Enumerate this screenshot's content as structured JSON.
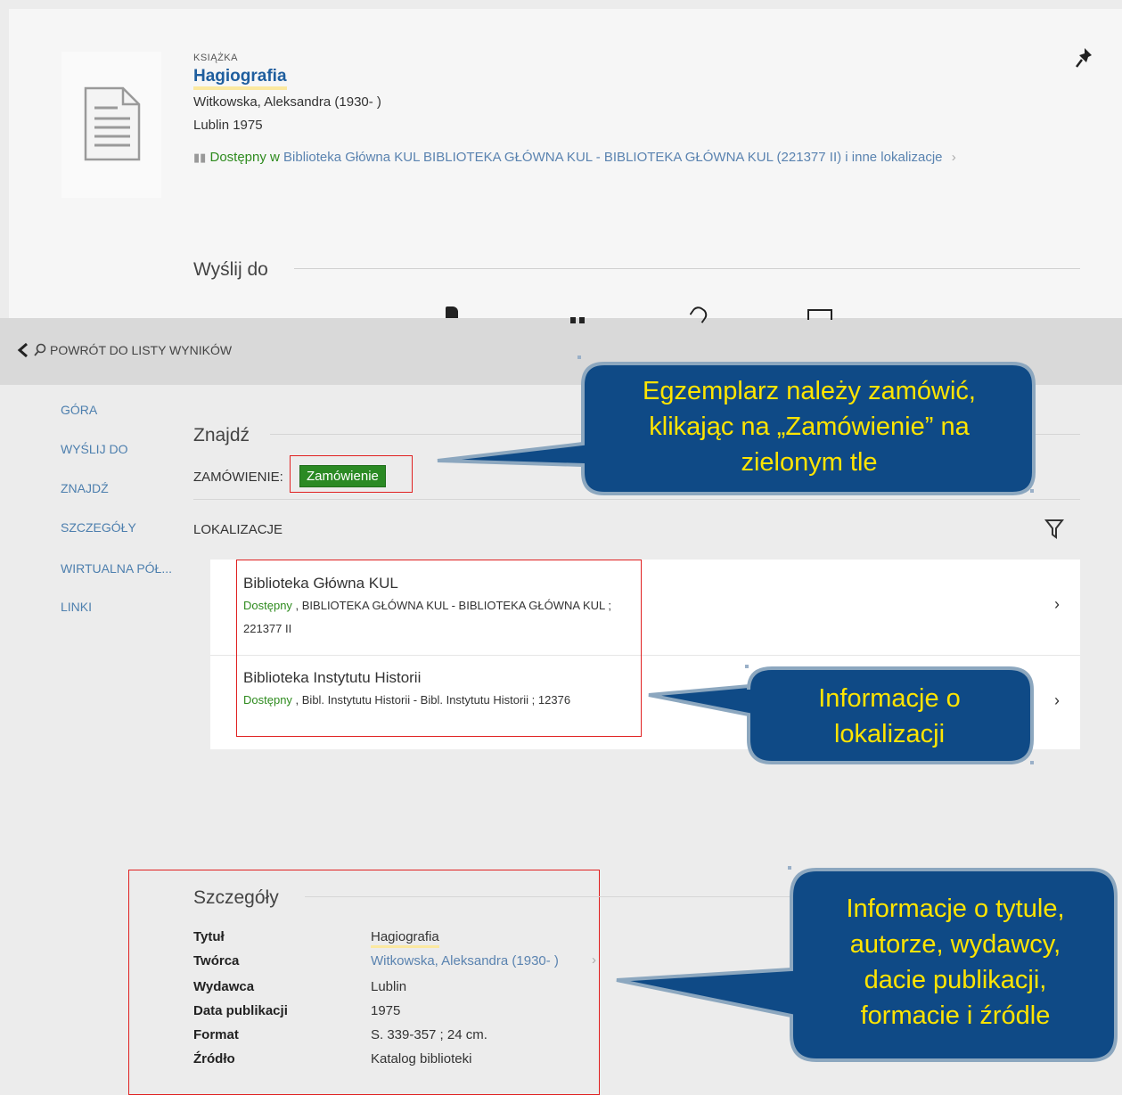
{
  "record": {
    "type": "KSIĄŻKA",
    "title": "Hagiografia",
    "author": "Witkowska, Aleksandra (1930- )",
    "place_year": "Lublin 1975",
    "availability_status": "Dostępny w",
    "availability_location": " Biblioteka Główna KUL  BIBLIOTEKA GŁÓWNA KUL - BIBLIOTEKA GŁÓWNA KUL (221377 II) i inne lokalizacje",
    "availability_chevron": "›"
  },
  "send_to": {
    "title": "Wyślij do"
  },
  "nav": {
    "back_label": "POWRÓT DO LISTY WYNIKÓW"
  },
  "sidebar": {
    "items": [
      {
        "label": "GÓRA"
      },
      {
        "label": "WYŚLIJ DO"
      },
      {
        "label": "ZNAJDŹ"
      },
      {
        "label": "SZCZEGÓŁY"
      },
      {
        "label": "WIRTUALNA PÓŁ..."
      },
      {
        "label": "LINKI"
      }
    ]
  },
  "find": {
    "title": "Znajdź",
    "order_label": "ZAMÓWIENIE:",
    "order_button": "Zamówienie",
    "locations_label": "LOKALIZACJE"
  },
  "locations": [
    {
      "name": "Biblioteka Główna KUL",
      "status": "Dostępny",
      "details": " , BIBLIOTEKA GŁÓWNA KUL - BIBLIOTEKA GŁÓWNA KUL ; 221377 II",
      "chevron": "›"
    },
    {
      "name": "Biblioteka Instytutu Historii",
      "status": "Dostępny",
      "details": " , Bibl. Instytutu Historii - Bibl. Instytutu Historii ; 12376",
      "chevron": "›"
    }
  ],
  "details": {
    "title": "Szczegóły",
    "rows": [
      {
        "key": "Tytuł",
        "value": "Hagiografia"
      },
      {
        "key": "Twórca",
        "value": "Witkowska, Aleksandra (1930- )"
      },
      {
        "key": "Wydawca",
        "value": "Lublin"
      },
      {
        "key": "Data publikacji",
        "value": "1975"
      },
      {
        "key": "Format",
        "value": "S. 339-357 ; 24 cm."
      },
      {
        "key": "Źródło",
        "value": "Katalog biblioteki"
      }
    ],
    "creator_chevron": "›"
  },
  "callouts": {
    "order": [
      "Egzemplarz należy zamówić,",
      "klikając na „Zamówienie” na",
      "zielonym tle"
    ],
    "location": [
      "Informacje o",
      "lokalizacji"
    ],
    "details": [
      "Informacje o tytule,",
      "autorze, wydawcy,",
      "dacie publikacji,",
      "formacie i źródle"
    ]
  },
  "colors": {
    "accent_blue": "#1f5e9e",
    "available_green": "#2e8b1e",
    "callout_fill": "#0f4a86",
    "callout_text": "#ffe400",
    "highlight_red": "#e02020"
  }
}
